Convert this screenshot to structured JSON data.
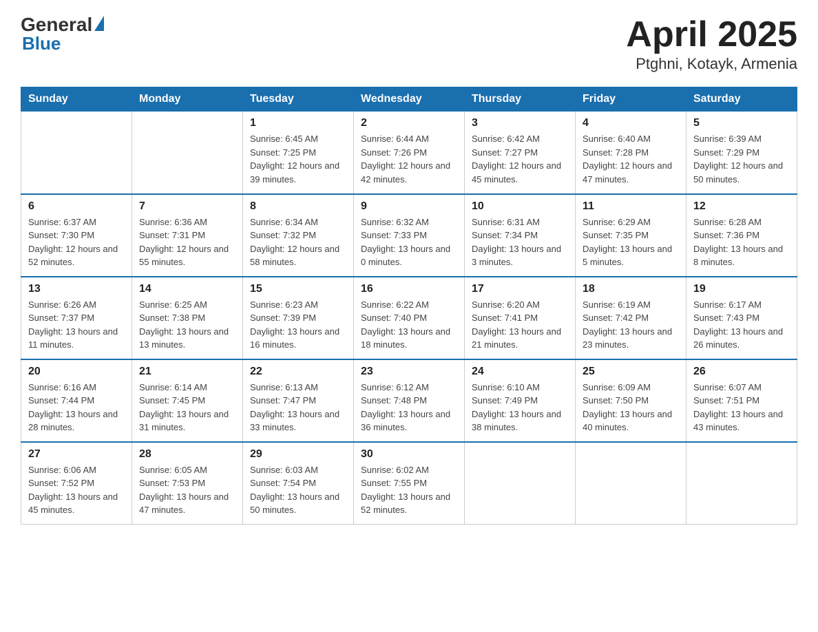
{
  "header": {
    "logo_general": "General",
    "logo_blue": "Blue",
    "title": "April 2025",
    "subtitle": "Ptghni, Kotayk, Armenia"
  },
  "calendar": {
    "days_of_week": [
      "Sunday",
      "Monday",
      "Tuesday",
      "Wednesday",
      "Thursday",
      "Friday",
      "Saturday"
    ],
    "weeks": [
      [
        {
          "day": "",
          "sunrise": "",
          "sunset": "",
          "daylight": ""
        },
        {
          "day": "",
          "sunrise": "",
          "sunset": "",
          "daylight": ""
        },
        {
          "day": "1",
          "sunrise": "Sunrise: 6:45 AM",
          "sunset": "Sunset: 7:25 PM",
          "daylight": "Daylight: 12 hours and 39 minutes."
        },
        {
          "day": "2",
          "sunrise": "Sunrise: 6:44 AM",
          "sunset": "Sunset: 7:26 PM",
          "daylight": "Daylight: 12 hours and 42 minutes."
        },
        {
          "day": "3",
          "sunrise": "Sunrise: 6:42 AM",
          "sunset": "Sunset: 7:27 PM",
          "daylight": "Daylight: 12 hours and 45 minutes."
        },
        {
          "day": "4",
          "sunrise": "Sunrise: 6:40 AM",
          "sunset": "Sunset: 7:28 PM",
          "daylight": "Daylight: 12 hours and 47 minutes."
        },
        {
          "day": "5",
          "sunrise": "Sunrise: 6:39 AM",
          "sunset": "Sunset: 7:29 PM",
          "daylight": "Daylight: 12 hours and 50 minutes."
        }
      ],
      [
        {
          "day": "6",
          "sunrise": "Sunrise: 6:37 AM",
          "sunset": "Sunset: 7:30 PM",
          "daylight": "Daylight: 12 hours and 52 minutes."
        },
        {
          "day": "7",
          "sunrise": "Sunrise: 6:36 AM",
          "sunset": "Sunset: 7:31 PM",
          "daylight": "Daylight: 12 hours and 55 minutes."
        },
        {
          "day": "8",
          "sunrise": "Sunrise: 6:34 AM",
          "sunset": "Sunset: 7:32 PM",
          "daylight": "Daylight: 12 hours and 58 minutes."
        },
        {
          "day": "9",
          "sunrise": "Sunrise: 6:32 AM",
          "sunset": "Sunset: 7:33 PM",
          "daylight": "Daylight: 13 hours and 0 minutes."
        },
        {
          "day": "10",
          "sunrise": "Sunrise: 6:31 AM",
          "sunset": "Sunset: 7:34 PM",
          "daylight": "Daylight: 13 hours and 3 minutes."
        },
        {
          "day": "11",
          "sunrise": "Sunrise: 6:29 AM",
          "sunset": "Sunset: 7:35 PM",
          "daylight": "Daylight: 13 hours and 5 minutes."
        },
        {
          "day": "12",
          "sunrise": "Sunrise: 6:28 AM",
          "sunset": "Sunset: 7:36 PM",
          "daylight": "Daylight: 13 hours and 8 minutes."
        }
      ],
      [
        {
          "day": "13",
          "sunrise": "Sunrise: 6:26 AM",
          "sunset": "Sunset: 7:37 PM",
          "daylight": "Daylight: 13 hours and 11 minutes."
        },
        {
          "day": "14",
          "sunrise": "Sunrise: 6:25 AM",
          "sunset": "Sunset: 7:38 PM",
          "daylight": "Daylight: 13 hours and 13 minutes."
        },
        {
          "day": "15",
          "sunrise": "Sunrise: 6:23 AM",
          "sunset": "Sunset: 7:39 PM",
          "daylight": "Daylight: 13 hours and 16 minutes."
        },
        {
          "day": "16",
          "sunrise": "Sunrise: 6:22 AM",
          "sunset": "Sunset: 7:40 PM",
          "daylight": "Daylight: 13 hours and 18 minutes."
        },
        {
          "day": "17",
          "sunrise": "Sunrise: 6:20 AM",
          "sunset": "Sunset: 7:41 PM",
          "daylight": "Daylight: 13 hours and 21 minutes."
        },
        {
          "day": "18",
          "sunrise": "Sunrise: 6:19 AM",
          "sunset": "Sunset: 7:42 PM",
          "daylight": "Daylight: 13 hours and 23 minutes."
        },
        {
          "day": "19",
          "sunrise": "Sunrise: 6:17 AM",
          "sunset": "Sunset: 7:43 PM",
          "daylight": "Daylight: 13 hours and 26 minutes."
        }
      ],
      [
        {
          "day": "20",
          "sunrise": "Sunrise: 6:16 AM",
          "sunset": "Sunset: 7:44 PM",
          "daylight": "Daylight: 13 hours and 28 minutes."
        },
        {
          "day": "21",
          "sunrise": "Sunrise: 6:14 AM",
          "sunset": "Sunset: 7:45 PM",
          "daylight": "Daylight: 13 hours and 31 minutes."
        },
        {
          "day": "22",
          "sunrise": "Sunrise: 6:13 AM",
          "sunset": "Sunset: 7:47 PM",
          "daylight": "Daylight: 13 hours and 33 minutes."
        },
        {
          "day": "23",
          "sunrise": "Sunrise: 6:12 AM",
          "sunset": "Sunset: 7:48 PM",
          "daylight": "Daylight: 13 hours and 36 minutes."
        },
        {
          "day": "24",
          "sunrise": "Sunrise: 6:10 AM",
          "sunset": "Sunset: 7:49 PM",
          "daylight": "Daylight: 13 hours and 38 minutes."
        },
        {
          "day": "25",
          "sunrise": "Sunrise: 6:09 AM",
          "sunset": "Sunset: 7:50 PM",
          "daylight": "Daylight: 13 hours and 40 minutes."
        },
        {
          "day": "26",
          "sunrise": "Sunrise: 6:07 AM",
          "sunset": "Sunset: 7:51 PM",
          "daylight": "Daylight: 13 hours and 43 minutes."
        }
      ],
      [
        {
          "day": "27",
          "sunrise": "Sunrise: 6:06 AM",
          "sunset": "Sunset: 7:52 PM",
          "daylight": "Daylight: 13 hours and 45 minutes."
        },
        {
          "day": "28",
          "sunrise": "Sunrise: 6:05 AM",
          "sunset": "Sunset: 7:53 PM",
          "daylight": "Daylight: 13 hours and 47 minutes."
        },
        {
          "day": "29",
          "sunrise": "Sunrise: 6:03 AM",
          "sunset": "Sunset: 7:54 PM",
          "daylight": "Daylight: 13 hours and 50 minutes."
        },
        {
          "day": "30",
          "sunrise": "Sunrise: 6:02 AM",
          "sunset": "Sunset: 7:55 PM",
          "daylight": "Daylight: 13 hours and 52 minutes."
        },
        {
          "day": "",
          "sunrise": "",
          "sunset": "",
          "daylight": ""
        },
        {
          "day": "",
          "sunrise": "",
          "sunset": "",
          "daylight": ""
        },
        {
          "day": "",
          "sunrise": "",
          "sunset": "",
          "daylight": ""
        }
      ]
    ]
  }
}
